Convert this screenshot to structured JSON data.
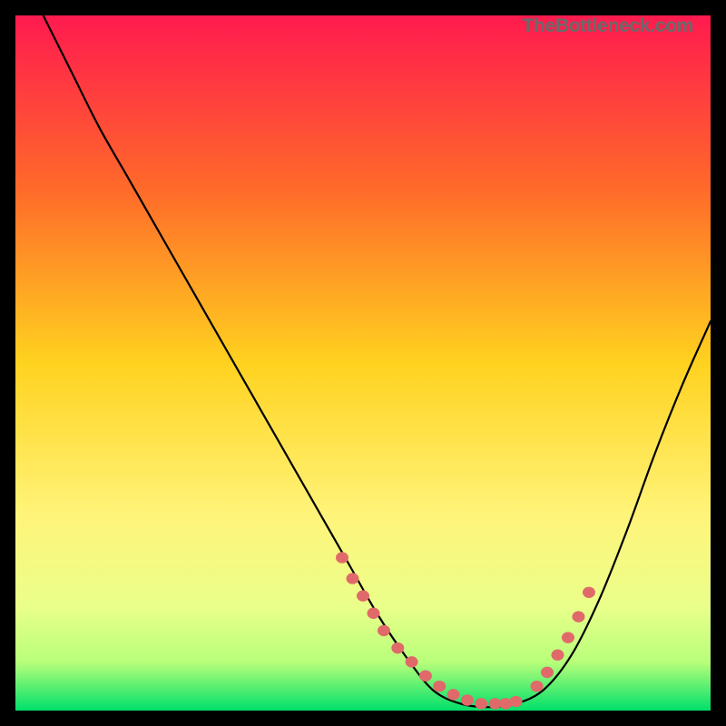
{
  "watermark": "TheBottleneck.com",
  "chart_data": {
    "type": "line",
    "title": "",
    "xlabel": "",
    "ylabel": "",
    "xlim": [
      0,
      100
    ],
    "ylim": [
      0,
      100
    ],
    "grid": false,
    "legend": false,
    "gradient_stops": [
      {
        "offset": 0,
        "color": "#ff1a4f"
      },
      {
        "offset": 25,
        "color": "#ff6a2a"
      },
      {
        "offset": 50,
        "color": "#ffd21f"
      },
      {
        "offset": 72,
        "color": "#fff47a"
      },
      {
        "offset": 85,
        "color": "#eaff8a"
      },
      {
        "offset": 93,
        "color": "#b8ff7a"
      },
      {
        "offset": 100,
        "color": "#00e06a"
      }
    ],
    "series": [
      {
        "name": "bottleneck-curve",
        "color": "#000000",
        "x": [
          4,
          8,
          12,
          16,
          20,
          24,
          28,
          32,
          36,
          40,
          44,
          48,
          52,
          56,
          60,
          64,
          68,
          72,
          76,
          80,
          84,
          88,
          92,
          96,
          100
        ],
        "y": [
          100,
          92,
          84,
          77,
          70,
          63,
          56,
          49,
          42,
          35,
          28,
          21,
          14,
          8,
          3,
          1,
          0.5,
          1,
          3,
          8,
          16,
          26,
          37,
          47,
          56
        ]
      },
      {
        "name": "recommended-markers",
        "color": "#e06a6a",
        "type": "scatter",
        "x": [
          47,
          48.5,
          50,
          51.5,
          53,
          55,
          57,
          59,
          61,
          63,
          65,
          67,
          69,
          70.5,
          72,
          75,
          76.5,
          78,
          79.5,
          81,
          82.5
        ],
        "y": [
          22,
          19,
          16.5,
          14,
          11.5,
          9,
          7,
          5,
          3.5,
          2.3,
          1.5,
          1,
          1,
          1,
          1.3,
          3.5,
          5.5,
          8,
          10.5,
          13.5,
          17
        ]
      }
    ]
  }
}
